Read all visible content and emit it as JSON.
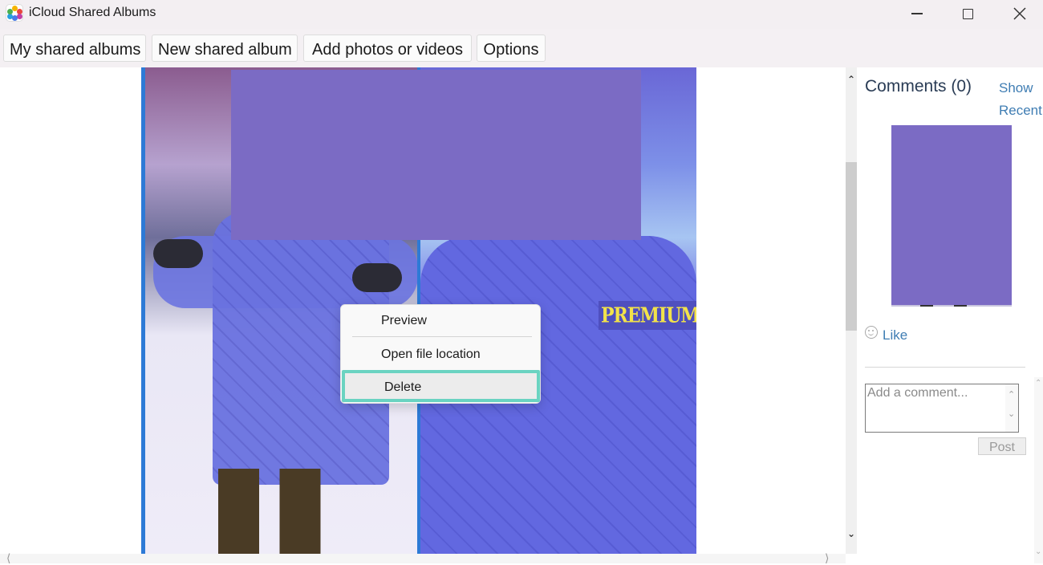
{
  "window": {
    "title": "iCloud Shared Albums",
    "controls": {
      "minimize": "minimize-icon",
      "maximize": "maximize-icon",
      "close": "close-icon"
    }
  },
  "toolbar": {
    "buttons": [
      {
        "label": "My shared albums"
      },
      {
        "label": "New shared album"
      },
      {
        "label": "Add photos or videos"
      },
      {
        "label": "Options"
      }
    ]
  },
  "photo": {
    "badge_text": "PREMIUM",
    "redaction_color": "#7b6bc4",
    "selection_border_color": "#2d7ad6"
  },
  "context_menu": {
    "items": [
      {
        "label": "Preview"
      },
      {
        "label": "Open file location"
      },
      {
        "label": "Delete",
        "highlighted": true
      }
    ],
    "highlight_color": "#6ad3c1"
  },
  "comments": {
    "title": "Comments (0)",
    "show_recent_label": "Show Recent",
    "like_label": "Like",
    "comment_placeholder": "Add a comment...",
    "post_label": "Post",
    "link_color": "#3f7db3"
  },
  "scrollbars": {
    "up_arrow": "^",
    "down_arrow": "v",
    "left_arrow": "<",
    "right_arrow": ">"
  }
}
